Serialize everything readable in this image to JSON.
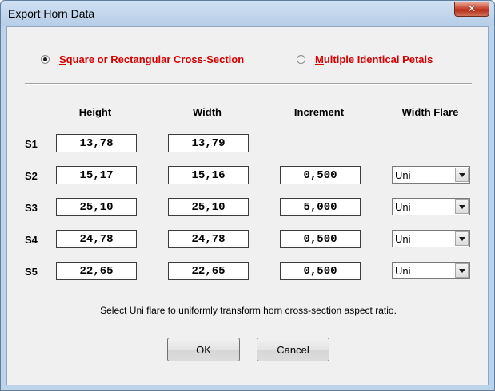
{
  "window": {
    "title": "Export Horn Data",
    "close_glyph": "✕"
  },
  "mode": {
    "options": [
      {
        "prefix": "S",
        "rest": "quare or Rectangular Cross-Section",
        "selected": true
      },
      {
        "prefix": "M",
        "rest": "ultiple Identical Petals",
        "selected": false
      }
    ],
    "label_color": "#d50000"
  },
  "table": {
    "headers": {
      "height": "Height",
      "width": "Width",
      "increment": "Increment",
      "width_flare": "Width Flare"
    },
    "rows": [
      {
        "label": "S1",
        "height": "13,78",
        "width": "13,79",
        "increment": "",
        "flare": ""
      },
      {
        "label": "S2",
        "height": "15,17",
        "width": "15,16",
        "increment": "0,500",
        "flare": "Uni"
      },
      {
        "label": "S3",
        "height": "25,10",
        "width": "25,10",
        "increment": "5,000",
        "flare": "Uni"
      },
      {
        "label": "S4",
        "height": "24,78",
        "width": "24,78",
        "increment": "0,500",
        "flare": "Uni"
      },
      {
        "label": "S5",
        "height": "22,65",
        "width": "22,65",
        "increment": "0,500",
        "flare": "Uni"
      }
    ]
  },
  "hint": "Select Uni flare to uniformly transform horn cross-section aspect ratio.",
  "buttons": {
    "ok": "OK",
    "cancel": "Cancel"
  },
  "icons": {
    "close": "close-icon",
    "dropdown": "chevron-down-icon"
  }
}
